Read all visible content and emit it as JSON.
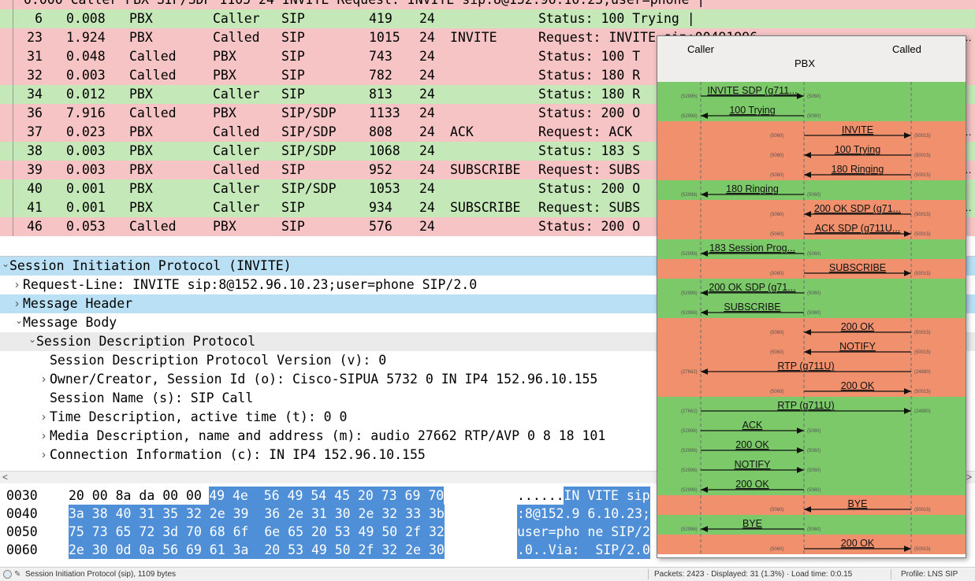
{
  "packet_list": {
    "partial_top_row": "0.000  Caller  PBX  SIP/SDP  1105  24  INVITE   Request: INVITE sip:8@152.96.10.23;user=phone |",
    "rows": [
      {
        "no": "6",
        "time": "0.008",
        "src": "PBX",
        "dst": "Caller",
        "proto": "SIP",
        "len": "419",
        "vlan": "24",
        "method": "",
        "info": "Status: 100 Trying |",
        "color": "#c4e8b8",
        "more": ""
      },
      {
        "no": "23",
        "time": "1.924",
        "src": "PBX",
        "dst": "Called",
        "proto": "SIP",
        "len": "1015",
        "vlan": "24",
        "method": "INVITE",
        "info": "Request: INVITE sip:00491996...",
        "color": "#f6c4c4",
        "more": "…"
      },
      {
        "no": "31",
        "time": "0.048",
        "src": "Called",
        "dst": "PBX",
        "proto": "SIP",
        "len": "743",
        "vlan": "24",
        "method": "",
        "info": "Status: 100 T",
        "color": "#f6c4c4",
        "more": ""
      },
      {
        "no": "32",
        "time": "0.003",
        "src": "Called",
        "dst": "PBX",
        "proto": "SIP",
        "len": "782",
        "vlan": "24",
        "method": "",
        "info": "Status: 180 R",
        "color": "#f6c4c4",
        "more": ""
      },
      {
        "no": "34",
        "time": "0.012",
        "src": "PBX",
        "dst": "Caller",
        "proto": "SIP",
        "len": "813",
        "vlan": "24",
        "method": "",
        "info": "Status: 180 R",
        "color": "#c4e8b8",
        "more": ""
      },
      {
        "no": "36",
        "time": "7.916",
        "src": "Called",
        "dst": "PBX",
        "proto": "SIP/SDP",
        "len": "1133",
        "vlan": "24",
        "method": "",
        "info": "Status: 200 O",
        "color": "#f6c4c4",
        "more": ""
      },
      {
        "no": "37",
        "time": "0.023",
        "src": "PBX",
        "dst": "Called",
        "proto": "SIP/SDP",
        "len": "808",
        "vlan": "24",
        "method": "ACK",
        "info": "Request: ACK",
        "color": "#f6c4c4",
        "more": "…"
      },
      {
        "no": "38",
        "time": "0.003",
        "src": "PBX",
        "dst": "Caller",
        "proto": "SIP/SDP",
        "len": "1068",
        "vlan": "24",
        "method": "",
        "info": "Status: 183 S",
        "color": "#c4e8b8",
        "more": ""
      },
      {
        "no": "39",
        "time": "0.003",
        "src": "PBX",
        "dst": "Called",
        "proto": "SIP",
        "len": "952",
        "vlan": "24",
        "method": "SUBSCRIBE",
        "info": "Request: SUBS",
        "color": "#f6c4c4",
        "more": "…"
      },
      {
        "no": "40",
        "time": "0.001",
        "src": "PBX",
        "dst": "Caller",
        "proto": "SIP/SDP",
        "len": "1053",
        "vlan": "24",
        "method": "",
        "info": "Status: 200 O",
        "color": "#c4e8b8",
        "more": ""
      },
      {
        "no": "41",
        "time": "0.001",
        "src": "PBX",
        "dst": "Caller",
        "proto": "SIP",
        "len": "934",
        "vlan": "24",
        "method": "SUBSCRIBE",
        "info": "Request: SUBS",
        "color": "#c4e8b8",
        "more": "…"
      },
      {
        "no": "46",
        "time": "0.053",
        "src": "Called",
        "dst": "PBX",
        "proto": "SIP",
        "len": "576",
        "vlan": "24",
        "method": "",
        "info": "Status: 200 O",
        "color": "#f6c4c4",
        "more": ""
      }
    ]
  },
  "details": {
    "rows": [
      {
        "twisty": "v",
        "text": "Session Initiation Protocol (INVITE)",
        "indent": 0,
        "bg": "#b9e0f5"
      },
      {
        "twisty": ">",
        "text": "Request-Line: INVITE sip:8@152.96.10.23;user=phone SIP/2.0",
        "indent": 1,
        "bg": "#ffffff"
      },
      {
        "twisty": ">",
        "text": "Message Header",
        "indent": 1,
        "bg": "#b9e0f5"
      },
      {
        "twisty": "v",
        "text": "Message Body",
        "indent": 1,
        "bg": "#ffffff"
      },
      {
        "twisty": "v",
        "text": "Session Description Protocol",
        "indent": 2,
        "bg": "#ebebeb"
      },
      {
        "twisty": "",
        "text": "Session Description Protocol Version (v): 0",
        "indent": 3,
        "bg": "#ffffff"
      },
      {
        "twisty": ">",
        "text": "Owner/Creator, Session Id (o): Cisco-SIPUA 5732 0 IN IP4 152.96.10.155",
        "indent": 3,
        "bg": "#ffffff"
      },
      {
        "twisty": "",
        "text": "Session Name (s): SIP Call",
        "indent": 3,
        "bg": "#ffffff"
      },
      {
        "twisty": ">",
        "text": "Time Description, active time (t): 0 0",
        "indent": 3,
        "bg": "#ffffff"
      },
      {
        "twisty": ">",
        "text": "Media Description, name and address (m): audio 27662 RTP/AVP 0 8 18 101",
        "indent": 3,
        "bg": "#ffffff"
      },
      {
        "twisty": ">",
        "text": "Connection Information (c): IN IP4 152.96.10.155",
        "indent": 3,
        "bg": "#ffffff"
      }
    ]
  },
  "scroll_arrows": {
    "left": "<",
    "right": ">"
  },
  "bytes": {
    "rows": [
      {
        "offset": "0030",
        "hex_plain": "20 00 8a da 00 00 ",
        "hex_hl": "49 4e  56 49 54 45 20 73 69 70",
        "ascii_plain": "......",
        "ascii_hl": "IN VITE sip"
      },
      {
        "offset": "0040",
        "hex_plain": "",
        "hex_hl": "3a 38 40 31 35 32 2e 39  36 2e 31 30 2e 32 33 3b",
        "ascii_plain": "",
        "ascii_hl": ":8@152.9 6.10.23;"
      },
      {
        "offset": "0050",
        "hex_plain": "",
        "hex_hl": "75 73 65 72 3d 70 68 6f  6e 65 20 53 49 50 2f 32",
        "ascii_plain": "",
        "ascii_hl": "user=pho ne SIP/2"
      },
      {
        "offset": "0060",
        "hex_plain": "",
        "hex_hl": "2e 30 0d 0a 56 69 61 3a  20 53 49 50 2f 32 2e 30",
        "ascii_plain": "",
        "ascii_hl": ".0..Via:  SIP/2.0"
      }
    ]
  },
  "status_bar": {
    "protocol_info": "Session Initiation Protocol (sip), 1109 bytes",
    "packets": "Packets: 2423 · Displayed: 31 (1.3%) · Load time: 0:0.15",
    "profile": "Profile: LNS SIP"
  },
  "flow": {
    "endpoints": {
      "caller": "Caller",
      "pbx": "PBX",
      "called": "Called"
    },
    "colors": {
      "green": "#7cc96a",
      "orange": "#f0906c",
      "line": "#111111"
    },
    "rows": [
      {
        "label": "INVITE SDP (g711...",
        "from": "caller",
        "to": "pbx",
        "bg": "green",
        "lport": "(52996)",
        "rport": "(5060)"
      },
      {
        "label": "100 Trying",
        "from": "pbx",
        "to": "caller",
        "bg": "green",
        "lport": "(52996)",
        "rport": "(5060)"
      },
      {
        "label": "INVITE",
        "from": "pbx",
        "to": "called",
        "bg": "orange",
        "lport": "(5060)",
        "rport": "(50015)"
      },
      {
        "label": "100 Trying",
        "from": "called",
        "to": "pbx",
        "bg": "orange",
        "lport": "(5060)",
        "rport": "(50015)"
      },
      {
        "label": "180 Ringing",
        "from": "called",
        "to": "pbx",
        "bg": "orange",
        "lport": "(5060)",
        "rport": "(50015)"
      },
      {
        "label": "180 Ringing",
        "from": "pbx",
        "to": "caller",
        "bg": "green",
        "lport": "(52996)",
        "rport": "(5060)"
      },
      {
        "label": "200 OK SDP (g71...",
        "from": "called",
        "to": "pbx",
        "bg": "orange",
        "lport": "(5060)",
        "rport": "(50015)"
      },
      {
        "label": "ACK SDP (g711U...",
        "from": "pbx",
        "to": "called",
        "bg": "orange",
        "lport": "(5060)",
        "rport": "(50015)"
      },
      {
        "label": "183 Session Prog...",
        "from": "pbx",
        "to": "caller",
        "bg": "green",
        "lport": "(52996)",
        "rport": "(5060)"
      },
      {
        "label": "SUBSCRIBE",
        "from": "pbx",
        "to": "called",
        "bg": "orange",
        "lport": "(5060)",
        "rport": "(50015)"
      },
      {
        "label": "200 OK SDP (g71...",
        "from": "pbx",
        "to": "caller",
        "bg": "green",
        "lport": "(52996)",
        "rport": "(5060)"
      },
      {
        "label": "SUBSCRIBE",
        "from": "pbx",
        "to": "caller",
        "bg": "green",
        "lport": "(52996)",
        "rport": "(5060)"
      },
      {
        "label": "200 OK",
        "from": "called",
        "to": "pbx",
        "bg": "orange",
        "lport": "(5060)",
        "rport": "(50015)"
      },
      {
        "label": "NOTIFY",
        "from": "called",
        "to": "pbx",
        "bg": "orange",
        "lport": "(5060)",
        "rport": "(50015)"
      },
      {
        "label": "RTP (g711U)",
        "from": "called",
        "to": "caller",
        "bg": "orange",
        "lport": "(27662)",
        "rport": "(24880)"
      },
      {
        "label": "200 OK",
        "from": "pbx",
        "to": "called",
        "bg": "orange",
        "lport": "(5060)",
        "rport": "(50015)"
      },
      {
        "label": "RTP (g711U)",
        "from": "caller",
        "to": "called",
        "bg": "green",
        "lport": "(27662)",
        "rport": "(24880)"
      },
      {
        "label": "ACK",
        "from": "caller",
        "to": "pbx",
        "bg": "green",
        "lport": "(52996)",
        "rport": "(5060)"
      },
      {
        "label": "200 OK",
        "from": "caller",
        "to": "pbx",
        "bg": "green",
        "lport": "(52996)",
        "rport": "(5060)"
      },
      {
        "label": "NOTIFY",
        "from": "caller",
        "to": "pbx",
        "bg": "green",
        "lport": "(52996)",
        "rport": "(5060)"
      },
      {
        "label": "200 OK",
        "from": "pbx",
        "to": "caller",
        "bg": "green",
        "lport": "(52996)",
        "rport": "(5060)"
      },
      {
        "label": "BYE",
        "from": "called",
        "to": "pbx",
        "bg": "orange",
        "lport": "(5060)",
        "rport": "(50015)"
      },
      {
        "label": "BYE",
        "from": "pbx",
        "to": "caller",
        "bg": "green",
        "lport": "(52996)",
        "rport": "(5060)"
      },
      {
        "label": "200 OK",
        "from": "pbx",
        "to": "called",
        "bg": "orange",
        "lport": "(5060)",
        "rport": "(50015)"
      }
    ]
  }
}
